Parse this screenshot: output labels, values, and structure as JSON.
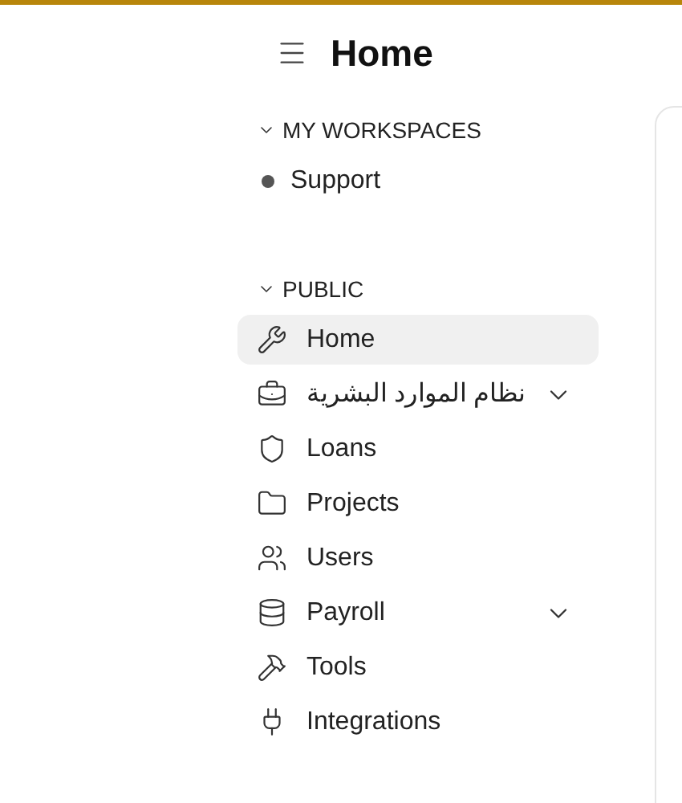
{
  "header": {
    "title": "Home"
  },
  "sections": [
    {
      "title": "MY WORKSPACES",
      "expanded": true,
      "kind": "workspaces",
      "items": [
        {
          "label": "Support",
          "selected": false,
          "expandable": false
        }
      ]
    },
    {
      "title": "PUBLIC",
      "expanded": true,
      "kind": "public",
      "items": [
        {
          "label": "Home",
          "selected": true,
          "expandable": false
        },
        {
          "label": "نظام الموارد البشرية",
          "selected": false,
          "expandable": true
        },
        {
          "label": "Loans",
          "selected": false,
          "expandable": false
        },
        {
          "label": "Projects",
          "selected": false,
          "expandable": false
        },
        {
          "label": "Users",
          "selected": false,
          "expandable": false
        },
        {
          "label": "Payroll",
          "selected": false,
          "expandable": true
        },
        {
          "label": "Tools",
          "selected": false,
          "expandable": false
        },
        {
          "label": "Integrations",
          "selected": false,
          "expandable": false
        }
      ]
    }
  ]
}
